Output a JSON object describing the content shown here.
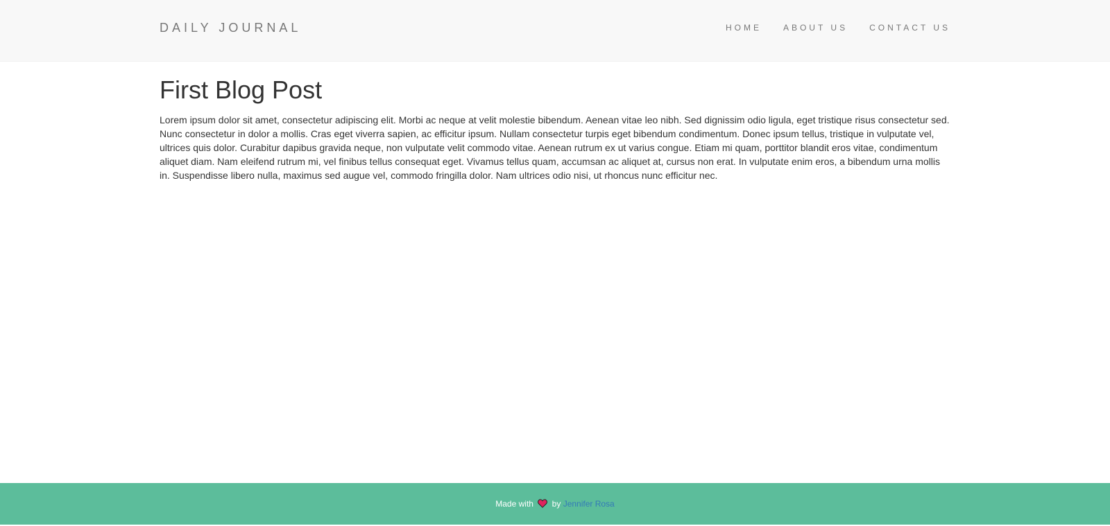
{
  "header": {
    "brand": "DAILY JOURNAL",
    "nav": [
      {
        "label": "HOME"
      },
      {
        "label": "ABOUT US"
      },
      {
        "label": "CONTACT US"
      }
    ]
  },
  "post": {
    "title": "First Blog Post",
    "body": "Lorem ipsum dolor sit amet, consectetur adipiscing elit. Morbi ac neque at velit molestie bibendum. Aenean vitae leo nibh. Sed dignissim odio ligula, eget tristique risus consectetur sed. Nunc consectetur in dolor a mollis. Cras eget viverra sapien, ac efficitur ipsum. Nullam consectetur turpis eget bibendum condimentum. Donec ipsum tellus, tristique in vulputate vel, ultrices quis dolor. Curabitur dapibus gravida neque, non vulputate velit commodo vitae. Aenean rutrum ex ut varius congue. Etiam mi quam, porttitor blandit eros vitae, condimentum aliquet diam. Nam eleifend rutrum mi, vel finibus tellus consequat eget. Vivamus tellus quam, accumsan ac aliquet at, cursus non erat. In vulputate enim eros, a bibendum urna mollis in. Suspendisse libero nulla, maximus sed augue vel, commodo fringilla dolor. Nam ultrices odio nisi, ut rhoncus nunc efficitur nec."
  },
  "footer": {
    "made_with": "Made with",
    "heart_icon": "heart-icon",
    "by": "by",
    "author": "Jennifer Rosa"
  },
  "colors": {
    "navbar_bg": "#f8f8f8",
    "footer_bg": "#5cbd9b",
    "link": "#337ab7",
    "heart": "#e0245e"
  }
}
